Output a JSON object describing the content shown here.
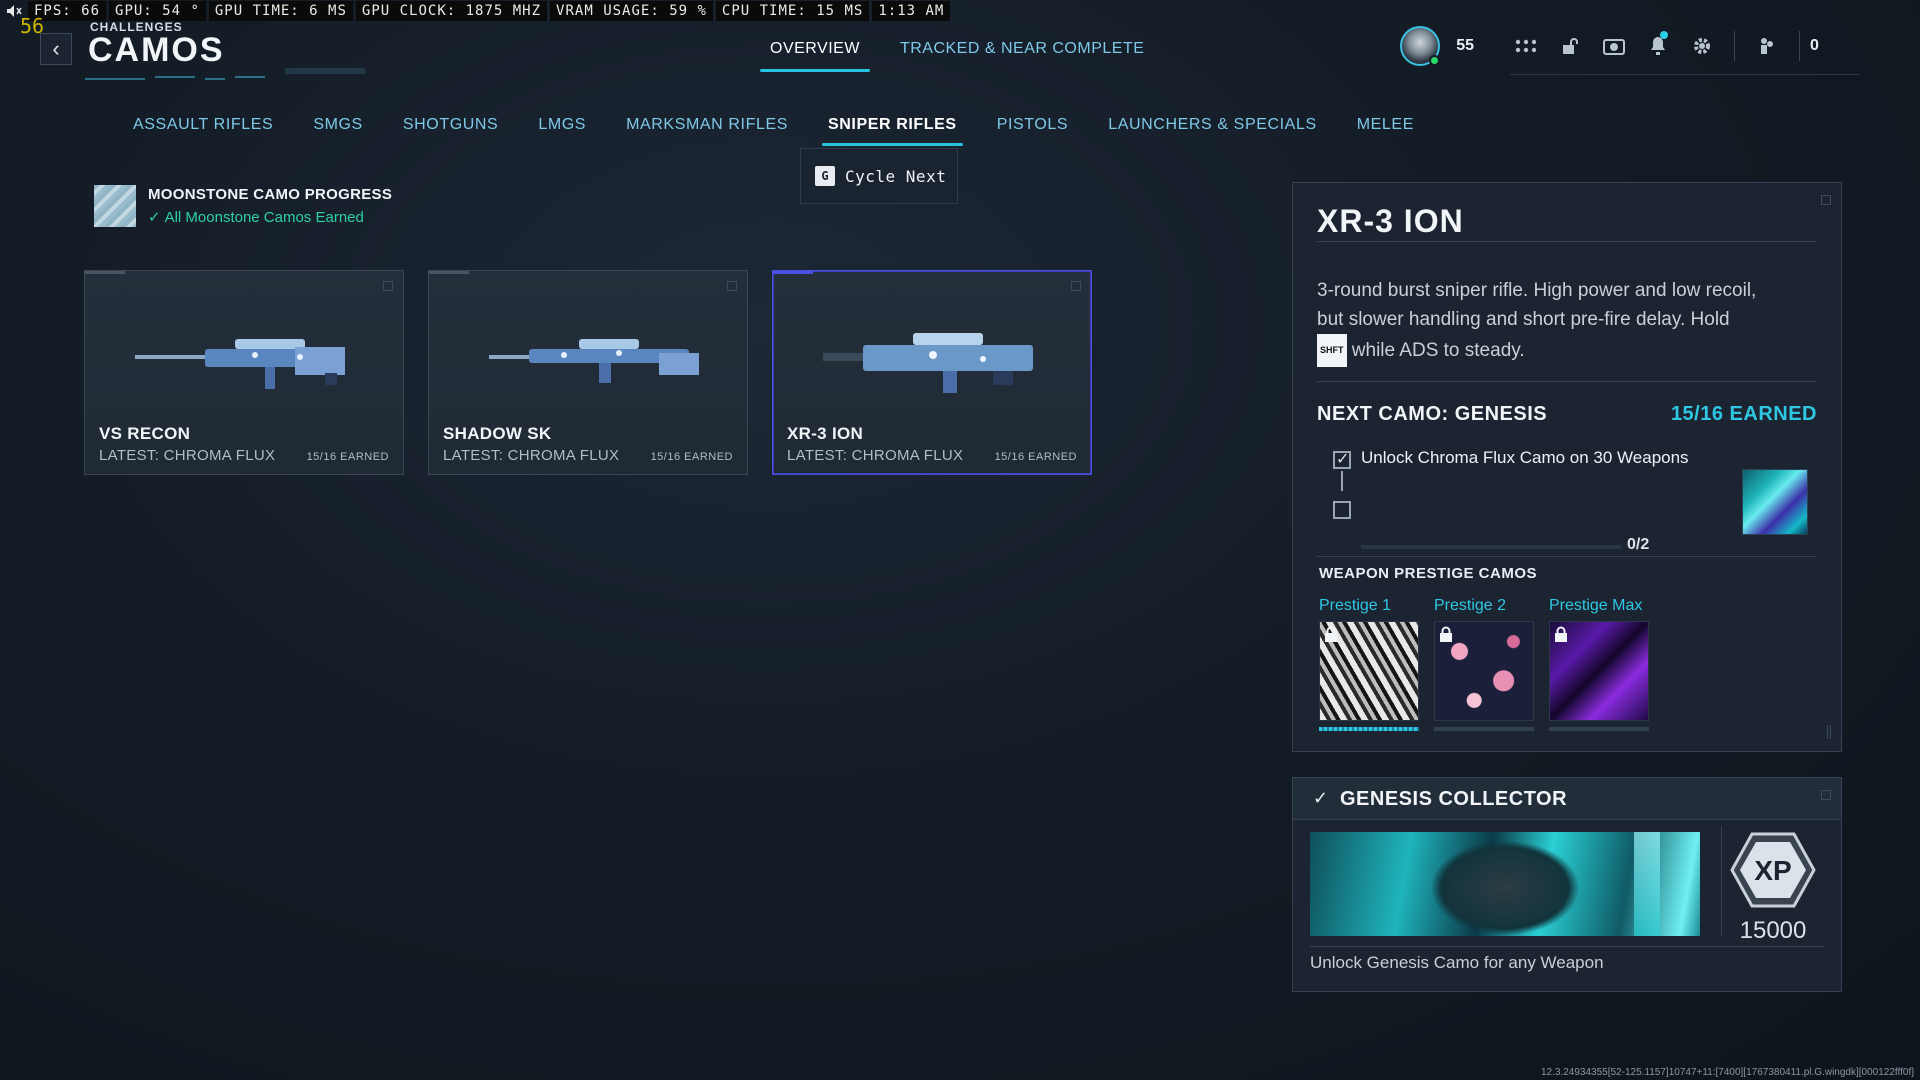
{
  "hud": {
    "fps": "FPS:  66",
    "gpu": "GPU: 54 °",
    "gpu_time": "GPU TIME:  6 MS",
    "gpu_clock": "GPU CLOCK: 1875 MHZ",
    "vram": "VRAM USAGE: 59 %",
    "cpu_time": "CPU TIME: 15 MS",
    "clock": "1:13 AM",
    "fps_overlay": "56"
  },
  "header": {
    "breadcrumb": "CHALLENGES",
    "title": "CAMOS",
    "tabs": [
      {
        "label": "OVERVIEW",
        "active": true
      },
      {
        "label": "TRACKED & NEAR COMPLETE",
        "active": false
      }
    ],
    "player_level": "55",
    "currency": "0"
  },
  "categories": [
    {
      "label": "ASSAULT RIFLES",
      "active": false
    },
    {
      "label": "SMGS",
      "active": false
    },
    {
      "label": "SHOTGUNS",
      "active": false
    },
    {
      "label": "LMGS",
      "active": false
    },
    {
      "label": "MARKSMAN RIFLES",
      "active": false
    },
    {
      "label": "SNIPER RIFLES",
      "active": true
    },
    {
      "label": "PISTOLS",
      "active": false
    },
    {
      "label": "LAUNCHERS & SPECIALS",
      "active": false
    },
    {
      "label": "MELEE",
      "active": false
    }
  ],
  "cycle_tip": {
    "key": "G",
    "label": "Cycle Next"
  },
  "moonstone": {
    "title": "MOONSTONE CAMO PROGRESS",
    "status": "All Moonstone Camos Earned"
  },
  "weapons": [
    {
      "name": "VS RECON",
      "latest": "LATEST: CHROMA FLUX",
      "earned": "15/16 EARNED",
      "selected": false
    },
    {
      "name": "SHADOW SK",
      "latest": "LATEST: CHROMA FLUX",
      "earned": "15/16 EARNED",
      "selected": false
    },
    {
      "name": "XR-3 ION",
      "latest": "LATEST: CHROMA FLUX",
      "earned": "15/16 EARNED",
      "selected": true
    }
  ],
  "detail": {
    "title": "XR-3 ION",
    "desc_part1": "3-round burst sniper rifle. High power and low recoil, but slower handling and short pre-fire delay. Hold",
    "desc_key": "SHFT",
    "desc_part2": "while ADS to steady.",
    "next_camo": "NEXT CAMO: GENESIS",
    "next_earned": "15/16 EARNED",
    "requirement": "Unlock Chroma Flux Camo on 30 Weapons",
    "progress_text": "0/2",
    "progress": 0,
    "prestige_header": "WEAPON PRESTIGE CAMOS",
    "prestige": [
      {
        "label": "Prestige 1",
        "locked": true,
        "progress": 1
      },
      {
        "label": "Prestige 2",
        "locked": true,
        "progress": 0
      },
      {
        "label": "Prestige Max",
        "locked": true,
        "progress": 0
      }
    ]
  },
  "collector": {
    "title": "GENESIS COLLECTOR",
    "xp": "15000",
    "xp_label": "XP",
    "desc": "Unlock Genesis Camo for any Weapon"
  },
  "build_id": "12.3.24934355[52-125.1157]10747+11:[7400][1767380411.pl.G.wingdk][000122fff0f]",
  "colors": {
    "accent": "#26c4e0",
    "success": "#2dd1a5",
    "selected": "#4a4fe8"
  }
}
